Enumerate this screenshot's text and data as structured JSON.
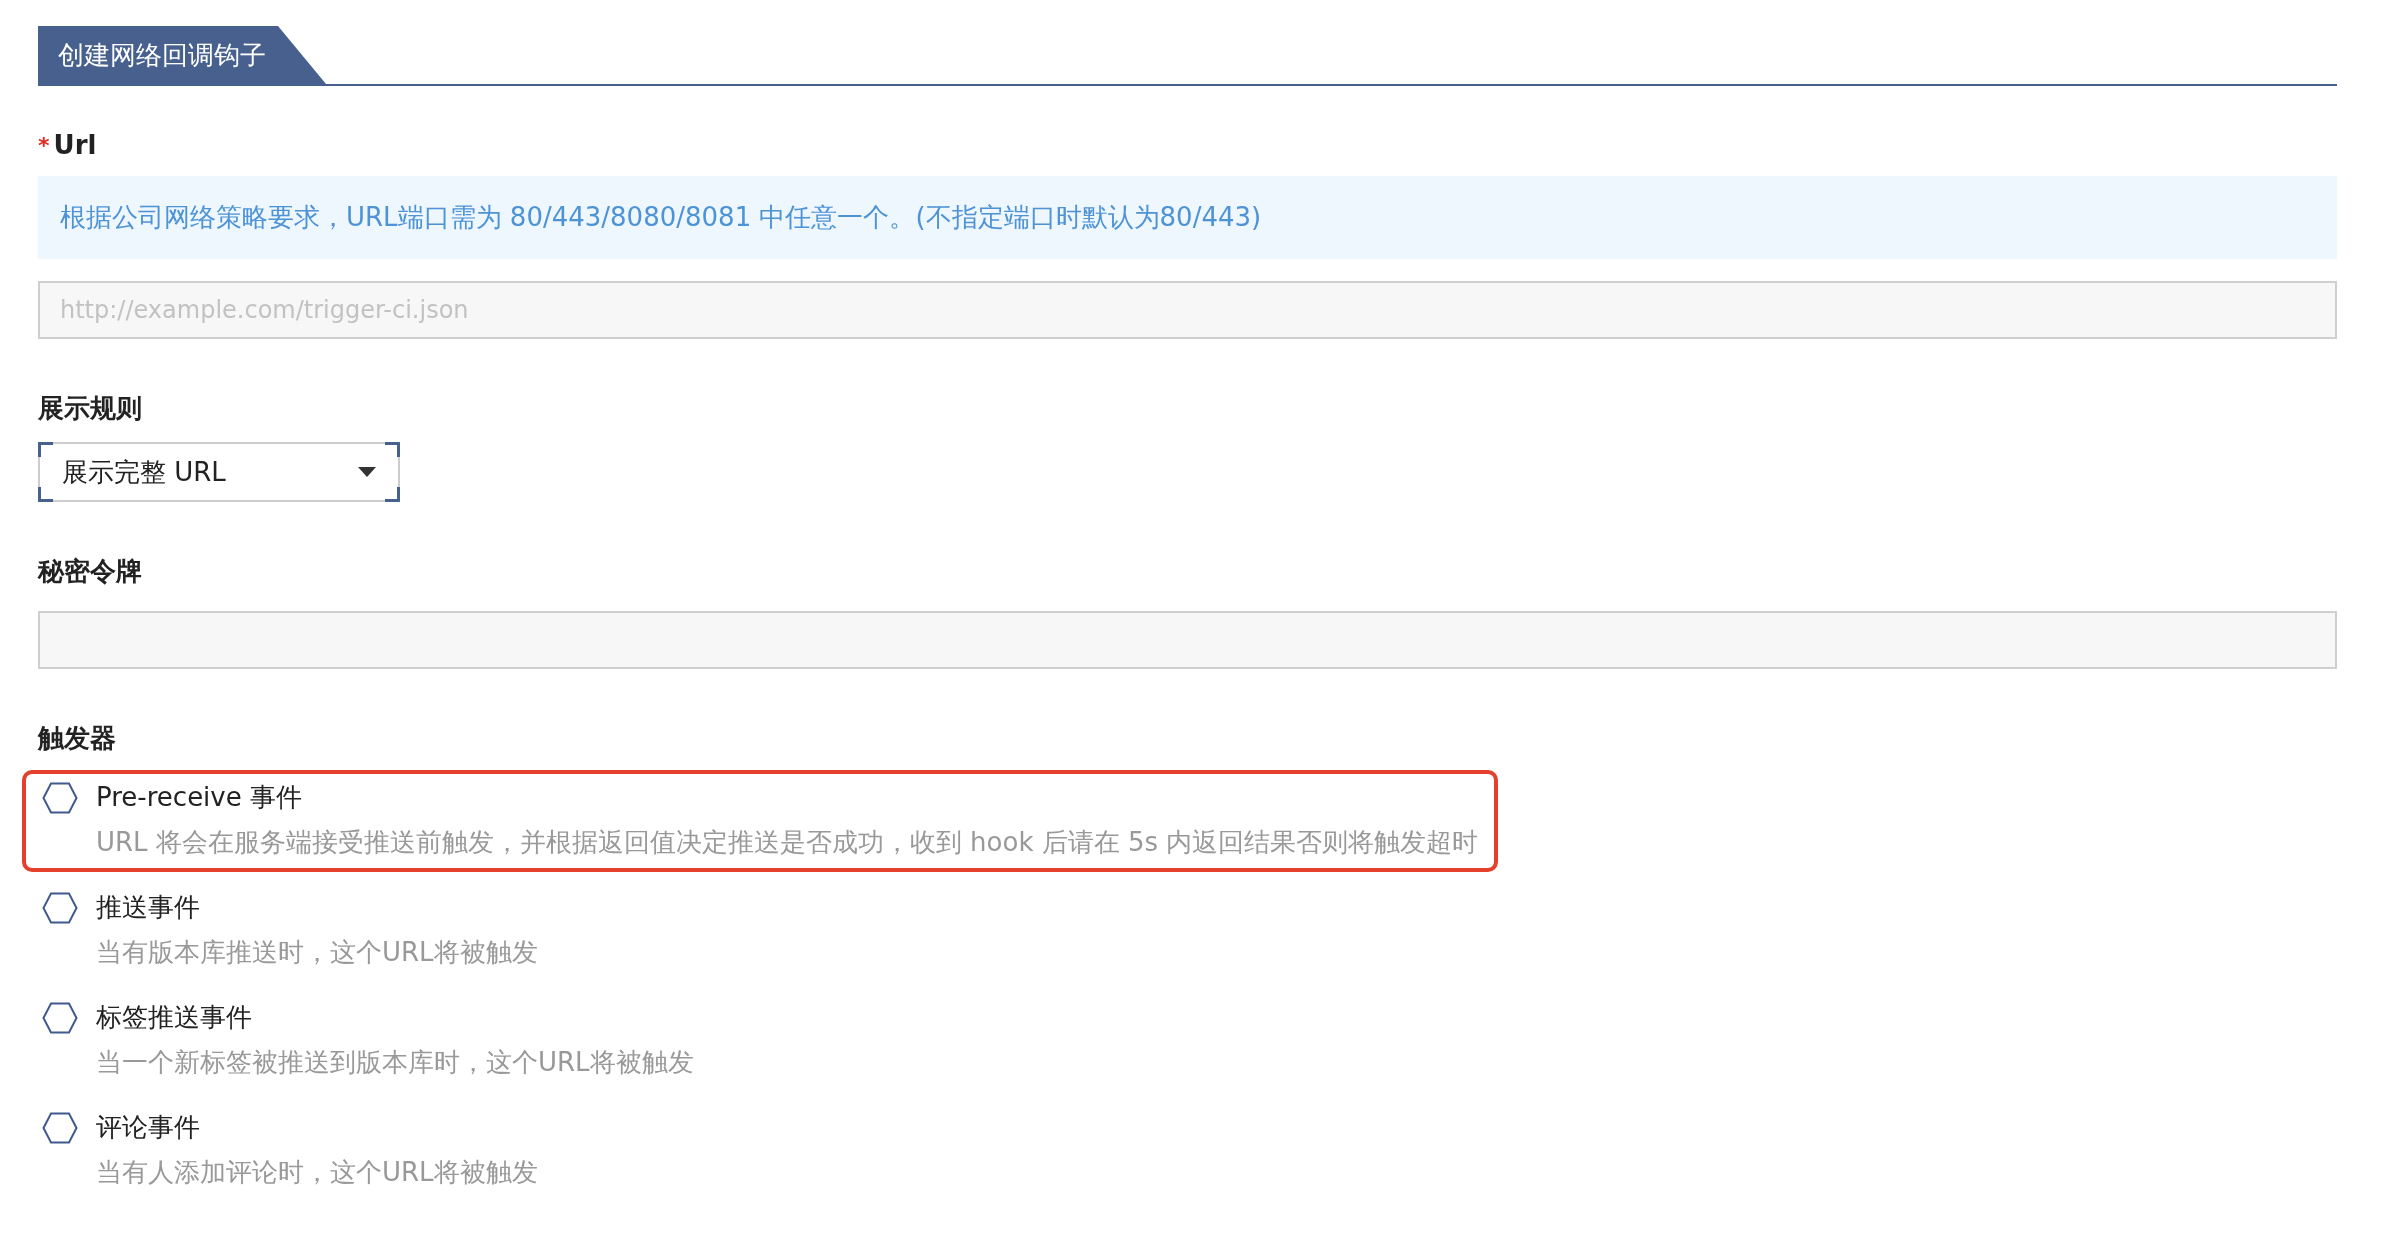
{
  "header": {
    "title": "创建网络回调钩子"
  },
  "url": {
    "label": "Url",
    "required_mark": "*",
    "notice": "根据公司网络策略要求，URL端口需为 80/443/8080/8081 中任意一个。(不指定端口时默认为80/443)",
    "placeholder": "http://example.com/trigger-ci.json"
  },
  "display_rule": {
    "label": "展示规则",
    "value": "展示完整 URL"
  },
  "secret_token": {
    "label": "秘密令牌"
  },
  "triggers": {
    "label": "触发器",
    "items": [
      {
        "title": "Pre-receive 事件",
        "description": "URL 将会在服务端接受推送前触发，并根据返回值决定推送是否成功，收到 hook 后请在 5s 内返回结果否则将触发超时",
        "checked": false,
        "highlighted": true
      },
      {
        "title": "推送事件",
        "description": "当有版本库推送时，这个URL将被触发",
        "checked": false,
        "highlighted": false
      },
      {
        "title": "标签推送事件",
        "description": "当一个新标签被推送到版本库时，这个URL将被触发",
        "checked": false,
        "highlighted": false
      },
      {
        "title": "评论事件",
        "description": "当有人添加评论时，这个URL将被触发",
        "checked": false,
        "highlighted": false
      }
    ]
  }
}
